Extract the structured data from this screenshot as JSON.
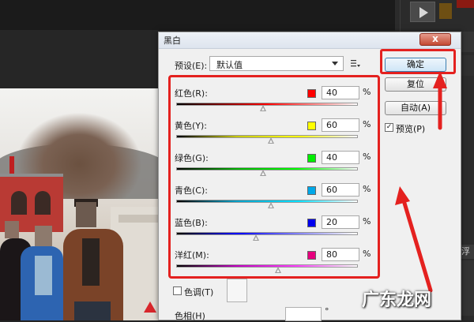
{
  "dialog": {
    "title": "黑白",
    "close_label": "x",
    "preset": {
      "label": "预设(E):",
      "value": "默认值"
    },
    "buttons": {
      "ok": "确定",
      "reset": "复位",
      "auto": "自动(A)"
    },
    "preview": {
      "label": "预览(P)",
      "checked": true,
      "check_mark": "✓"
    },
    "sliders": [
      {
        "label": "红色(R):",
        "value": "40",
        "value_num": 40,
        "swatch": "#ff0000",
        "track": "linear-gradient(90deg,#000,#ff0000,#fff)",
        "unit": "%"
      },
      {
        "label": "黄色(Y):",
        "value": "60",
        "value_num": 60,
        "swatch": "#ffff00",
        "track": "linear-gradient(90deg,#000,#c8c800,#ffff00,#fff)",
        "unit": "%"
      },
      {
        "label": "绿色(G):",
        "value": "40",
        "value_num": 40,
        "swatch": "#00ee00",
        "track": "linear-gradient(90deg,#000,#00b000,#00ff00,#fff)",
        "unit": "%"
      },
      {
        "label": "青色(C):",
        "value": "60",
        "value_num": 60,
        "swatch": "#00a8e8",
        "track": "linear-gradient(90deg,#000,#00a0c8,#00e0ff,#fff)",
        "unit": "%"
      },
      {
        "label": "蓝色(B):",
        "value": "20",
        "value_num": 20,
        "swatch": "#0000ee",
        "track": "linear-gradient(90deg,#000,#0000ff,#8080ff,#fff)",
        "unit": "%"
      },
      {
        "label": "洋红(M):",
        "value": "80",
        "value_num": 80,
        "swatch": "#e6007e",
        "track": "linear-gradient(90deg,#000,#c000c0,#ff40ff,#fff)",
        "unit": "%"
      }
    ],
    "tint": {
      "label": "色调(T)",
      "checked": false
    },
    "hue": {
      "label": "色相(H)",
      "unit": "°"
    }
  },
  "panel": {
    "tab_label": "浮"
  },
  "slider_range": [
    -200,
    300
  ],
  "watermark": "广东龙网",
  "colors": {
    "highlight": "#e4211f",
    "accent_button": "#3c7fb1"
  },
  "icons": [
    "play-icon",
    "close-icon",
    "dropdown-caret-icon",
    "preset-menu-icon",
    "checkbox-icon",
    "red-arrow-icon"
  ]
}
